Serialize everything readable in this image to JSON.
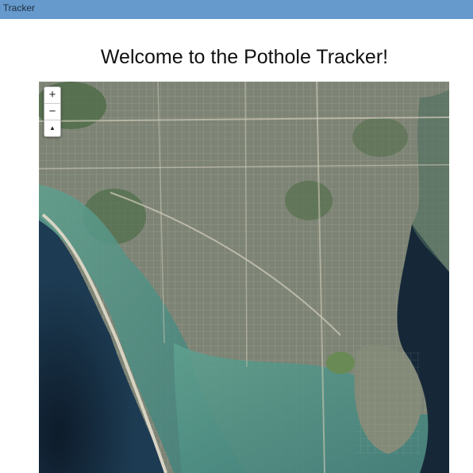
{
  "app": {
    "title": "e Tracker"
  },
  "page": {
    "heading": "Welcome to the Pothole Tracker!"
  },
  "map": {
    "view": "satellite",
    "controls": {
      "zoom_in": "+",
      "zoom_out": "−",
      "compass": "▲"
    }
  }
}
